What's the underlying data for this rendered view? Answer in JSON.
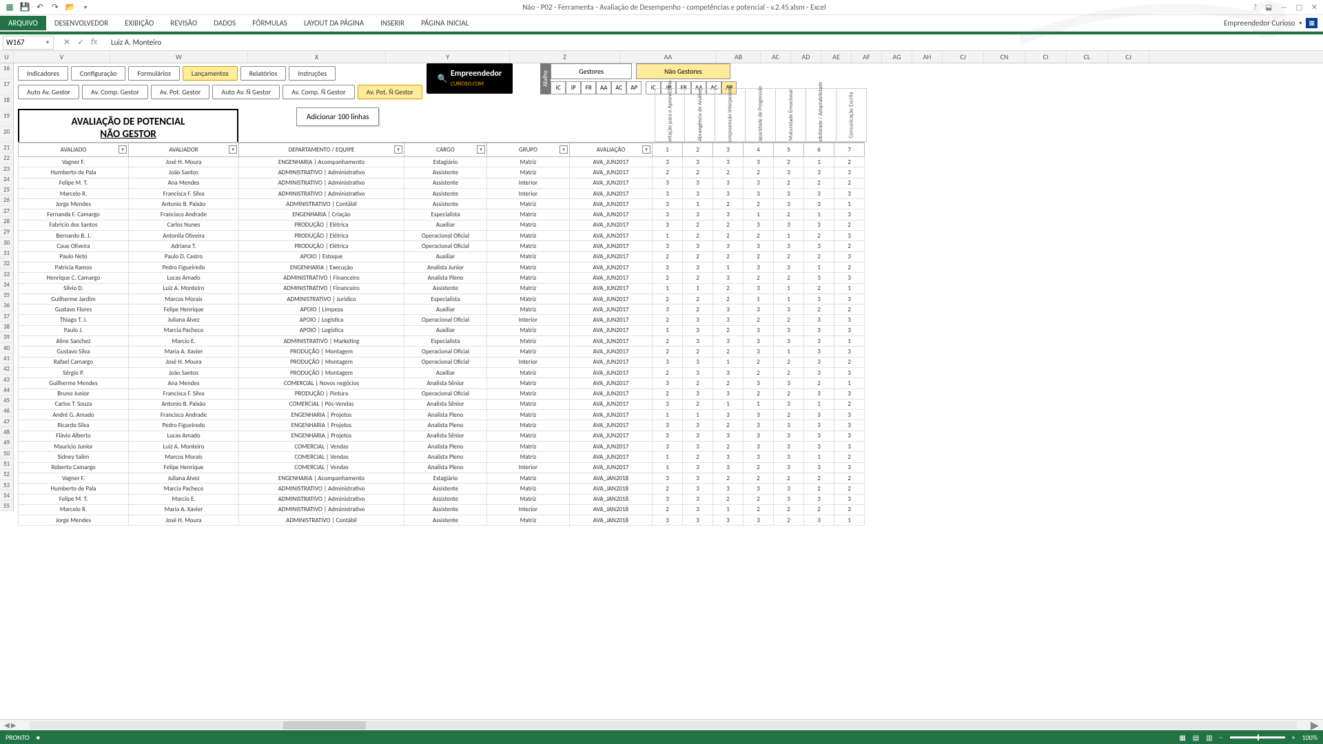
{
  "app": {
    "title": "Não - P02 - Ferramenta - Avaliação de Desempenho - competências e potencial - v.2.45.xlsm - Excel",
    "user_label": "Empreendedor Curioso"
  },
  "ribbon": {
    "file": "ARQUIVO",
    "tabs": [
      "PÁGINA INICIAL",
      "INSERIR",
      "LAYOUT DA PÁGINA",
      "FÓRMULAS",
      "DADOS",
      "REVISÃO",
      "EXIBIÇÃO",
      "DESENVOLVEDOR"
    ]
  },
  "namebox": {
    "ref": "W167",
    "formula": "Luiz A. Monteiro"
  },
  "col_letters": [
    "U",
    "V",
    "W",
    "X",
    "Y",
    "Z",
    "AA",
    "AB",
    "AC",
    "AD",
    "AE",
    "AF",
    "AG",
    "AH",
    "CJ",
    "CN",
    "CI",
    "CL",
    "CJ"
  ],
  "buttons_row1": [
    {
      "label": "Indicadores",
      "hl": false
    },
    {
      "label": "Configuração",
      "hl": false
    },
    {
      "label": "Formulários",
      "hl": false
    },
    {
      "label": "Lançamentos",
      "hl": true
    },
    {
      "label": "Relatórios",
      "hl": false
    },
    {
      "label": "Instruções",
      "hl": false
    }
  ],
  "buttons_row2": [
    {
      "label": "Auto Av. Gestor",
      "hl": false
    },
    {
      "label": "Av. Comp. Gestor",
      "hl": false
    },
    {
      "label": "Av. Pot. Gestor",
      "hl": false
    },
    {
      "label": "Auto Av. Ñ Gestor",
      "hl": false
    },
    {
      "label": "Av. Comp. Ñ Gestor",
      "hl": false
    },
    {
      "label": "Av. Pot. Ñ Gestor",
      "hl": true
    }
  ],
  "logo": {
    "brand": "Empreendedor",
    "sub": "CURIOSO.COM"
  },
  "atalho": {
    "label": "Atalho"
  },
  "top_big": [
    {
      "label": "Gestores",
      "hl": false
    },
    {
      "label": "Não Gestores",
      "hl": true
    }
  ],
  "mini_g": [
    "IC",
    "IP",
    "FR",
    "AA",
    "AC",
    "AP"
  ],
  "mini_ng": [
    "IC",
    "IP",
    "FR",
    "AA",
    "AC",
    "AP"
  ],
  "panel": {
    "title": "AVALIAÇÃO DE POTENCIAL",
    "subtitle": "NÃO GESTOR",
    "add_btn": "Adicionar 100 linhas"
  },
  "rot_headers": [
    "Orientação para o Aprendizado",
    "Abrangência de Análise",
    "Compreensão Interpessoal",
    "Capacidade de Progressão",
    "Maturidade Emocional",
    "Flexibilidade / Adaptabilidade",
    "Comunicação Escrita"
  ],
  "table": {
    "headers": [
      "AVALIADO",
      "AVALIADOR",
      "DEPARTAMENTO / EQUIPE",
      "CARGO",
      "GRUPO",
      "AVALIAÇÃO",
      "1",
      "2",
      "3",
      "4",
      "5",
      "6",
      "7"
    ],
    "rows": [
      [
        "Vagner F.",
        "José H. Moura",
        "ENGENHARIA | Acompanhamento",
        "Estagiário",
        "Matriz",
        "AVA_JUN2017",
        "3",
        "3",
        "3",
        "3",
        "2",
        "1",
        "2"
      ],
      [
        "Humberto de Pala",
        "João Santos",
        "ADMINISTRATIVO | Administrativo",
        "Assistente",
        "Matriz",
        "AVA_JUN2017",
        "2",
        "2",
        "2",
        "2",
        "3",
        "3",
        "3"
      ],
      [
        "Felipe M. T.",
        "Ana Mendes",
        "ADMINISTRATIVO | Administrativo",
        "Assistente",
        "Interior",
        "AVA_JUN2017",
        "3",
        "3",
        "3",
        "3",
        "2",
        "2",
        "2"
      ],
      [
        "Marcelo R.",
        "Francisca F. Silva",
        "ADMINISTRATIVO | Administrativo",
        "Assistente",
        "Interior",
        "AVA_JUN2017",
        "3",
        "3",
        "3",
        "3",
        "3",
        "3",
        "3"
      ],
      [
        "Jorge Mendes",
        "Antonio B. Paixão",
        "ADMINISTRATIVO | Contábil",
        "Assistente",
        "Matriz",
        "AVA_JUN2017",
        "3",
        "1",
        "2",
        "2",
        "3",
        "3",
        "1"
      ],
      [
        "Fernanda F. Camargo",
        "Francisco Andrade",
        "ENGENHARIA | Criação",
        "Especialista",
        "Matriz",
        "AVA_JUN2017",
        "3",
        "3",
        "3",
        "1",
        "2",
        "1",
        "3"
      ],
      [
        "Fabricio dos Santos",
        "Carlos Nunes",
        "PRODUÇÃO | Elétrica",
        "Auxiliar",
        "Matriz",
        "AVA_JUN2017",
        "3",
        "2",
        "2",
        "3",
        "3",
        "3",
        "2"
      ],
      [
        "Bernardo B. J.",
        "Antoniia Oliveira",
        "PRODUÇÃO | Elétrica",
        "Operacional Oficial",
        "Matriz",
        "AVA_JUN2017",
        "1",
        "2",
        "2",
        "2",
        "1",
        "2",
        "3"
      ],
      [
        "Caue Oliveira",
        "Adriana T.",
        "PRODUÇÃO | Elétrica",
        "Operacional Oficial",
        "Matriz",
        "AVA_JUN2017",
        "3",
        "3",
        "3",
        "3",
        "3",
        "3",
        "2"
      ],
      [
        "Paulo Neto",
        "Paulo D. Castro",
        "APOIO | Estoque",
        "Auxiliar",
        "Matriz",
        "AVA_JUN2017",
        "2",
        "2",
        "2",
        "2",
        "2",
        "2",
        "3"
      ],
      [
        "Patricia Ramos",
        "Pedro Figueiredo",
        "ENGENHARIA | Execução",
        "Analista Junior",
        "Matriz",
        "AVA_JUN2017",
        "3",
        "3",
        "1",
        "3",
        "3",
        "1",
        "2"
      ],
      [
        "Henrique C. Camargo",
        "Lucas Amado",
        "ADMINISTRATIVO | Financeiro",
        "Analista Pleno",
        "Matriz",
        "AVA_JUN2017",
        "2",
        "2",
        "3",
        "2",
        "2",
        "3",
        "3"
      ],
      [
        "Silvio D.",
        "Luiz A. Monteiro",
        "ADMINISTRATIVO | Financeiro",
        "Assistente",
        "Matriz",
        "AVA_JUN2017",
        "1",
        "1",
        "2",
        "3",
        "1",
        "2",
        "1"
      ],
      [
        "Guilherme Jardim",
        "Marcos Morais",
        "ADMINISTRATIVO | Jurídico",
        "Especialista",
        "Matriz",
        "AVA_JUN2017",
        "2",
        "2",
        "2",
        "1",
        "1",
        "3",
        "3"
      ],
      [
        "Gustavo Flores",
        "Felipe Henrique",
        "APOIO | Limpeza",
        "Auxiliar",
        "Matriz",
        "AVA_JUN2017",
        "3",
        "2",
        "3",
        "3",
        "3",
        "2",
        "2"
      ],
      [
        "Thiago T. J.",
        "Juliana Alvez",
        "APOIO | Logística",
        "Operacional Oficial",
        "Interior",
        "AVA_JUN2017",
        "2",
        "3",
        "3",
        "2",
        "2",
        "3",
        "3"
      ],
      [
        "Paulo J.",
        "Marcia Pacheco",
        "APOIO | Logística",
        "Auxiliar",
        "Matriz",
        "AVA_JUN2017",
        "1",
        "3",
        "2",
        "3",
        "3",
        "3",
        "3"
      ],
      [
        "Aline Sanchez",
        "Marcio E.",
        "ADMINISTRATIVO | Marketing",
        "Especialista",
        "Matriz",
        "AVA_JUN2017",
        "2",
        "3",
        "3",
        "3",
        "3",
        "3",
        "1"
      ],
      [
        "Gustavo Silva",
        "Maria A. Xavier",
        "PRODUÇÃO | Montagem",
        "Operacional Oficial",
        "Matriz",
        "AVA_JUN2017",
        "2",
        "2",
        "2",
        "3",
        "1",
        "3",
        "3"
      ],
      [
        "Rafael Camargo",
        "José H. Moura",
        "PRODUÇÃO | Montagem",
        "Operacional Oficial",
        "Interior",
        "AVA_JUN2017",
        "3",
        "3",
        "1",
        "2",
        "2",
        "3",
        "2"
      ],
      [
        "Sérgio P.",
        "João Santos",
        "PRODUÇÃO | Montagem",
        "Auxiliar",
        "Matriz",
        "AVA_JUN2017",
        "2",
        "3",
        "3",
        "2",
        "2",
        "3",
        "3"
      ],
      [
        "Guilherme Mendes",
        "Ana Mendes",
        "COMERCIAL | Novos negócios",
        "Analista Sênior",
        "Matriz",
        "AVA_JUN2017",
        "3",
        "2",
        "2",
        "3",
        "3",
        "2",
        "1"
      ],
      [
        "Bruno Junior",
        "Francisca F. Silva",
        "PRODUÇÃO | Pintura",
        "Operacional Oficial",
        "Matriz",
        "AVA_JUN2017",
        "2",
        "3",
        "3",
        "2",
        "2",
        "3",
        "3"
      ],
      [
        "Carlos T. Souza",
        "Antonio B. Paixão",
        "COMERCIAL | Pós-Vendas",
        "Analista Sênior",
        "Matriz",
        "AVA_JUN2017",
        "3",
        "2",
        "1",
        "1",
        "3",
        "1",
        "2"
      ],
      [
        "André G. Amado",
        "Francisco Andrade",
        "ENGENHARIA | Projetos",
        "Analista Pleno",
        "Matriz",
        "AVA_JUN2017",
        "1",
        "1",
        "3",
        "3",
        "2",
        "3",
        "3"
      ],
      [
        "Ricardo Silva",
        "Pedro Figueiredo",
        "ENGENHARIA | Projetos",
        "Analista Pleno",
        "Matriz",
        "AVA_JUN2017",
        "3",
        "3",
        "2",
        "3",
        "3",
        "3",
        "3"
      ],
      [
        "Flávio Alberto",
        "Lucas Amado",
        "ENGENHARIA | Projetos",
        "Analista Sênior",
        "Matriz",
        "AVA_JUN2017",
        "3",
        "3",
        "3",
        "3",
        "3",
        "3",
        "3"
      ],
      [
        "Mauricio Junior",
        "Luiz A. Monteiro",
        "COMERCIAL | Vendas",
        "Analista Pleno",
        "Matriz",
        "AVA_JUN2017",
        "3",
        "3",
        "2",
        "3",
        "3",
        "3",
        "3"
      ],
      [
        "Sidney Salim",
        "Marcos Morais",
        "COMERCIAL | Vendas",
        "Analista Pleno",
        "Matriz",
        "AVA_JUN2017",
        "1",
        "2",
        "3",
        "3",
        "3",
        "1",
        "2"
      ],
      [
        "Roberto Camargo",
        "Felipe Henrique",
        "COMERCIAL | Vendas",
        "Analista Pleno",
        "Interior",
        "AVA_JUN2017",
        "1",
        "3",
        "3",
        "2",
        "3",
        "3",
        "3"
      ],
      [
        "Vagner F.",
        "Juliana Alvez",
        "ENGENHARIA | Acompanhamento",
        "Estagiário",
        "Matriz",
        "AVA_JAN2018",
        "3",
        "3",
        "2",
        "2",
        "2",
        "2",
        "2"
      ],
      [
        "Humberto de Pala",
        "Marcia Pacheco",
        "ADMINISTRATIVO | Administrativo",
        "Assistente",
        "Matriz",
        "AVA_JAN2018",
        "2",
        "3",
        "3",
        "3",
        "3",
        "2",
        "2"
      ],
      [
        "Felipe M. T.",
        "Marcio E.",
        "ADMINISTRATIVO | Administrativo",
        "Assistente",
        "Matriz",
        "AVA_JAN2018",
        "3",
        "3",
        "2",
        "2",
        "3",
        "3",
        "3"
      ],
      [
        "Marcelo R.",
        "Maria A. Xavier",
        "ADMINISTRATIVO | Administrativo",
        "Assistente",
        "Interior",
        "AVA_JAN2018",
        "2",
        "3",
        "1",
        "2",
        "2",
        "2",
        "3"
      ],
      [
        "Jorge Mendes",
        "José H. Moura",
        "ADMINISTRATIVO | Contábil",
        "Assistente",
        "Matriz",
        "AVA_JAN2018",
        "3",
        "3",
        "3",
        "3",
        "2",
        "3",
        "1"
      ]
    ]
  },
  "row_numbers_start": 16,
  "status": {
    "ready": "PRONTO",
    "zoom": "100%"
  }
}
